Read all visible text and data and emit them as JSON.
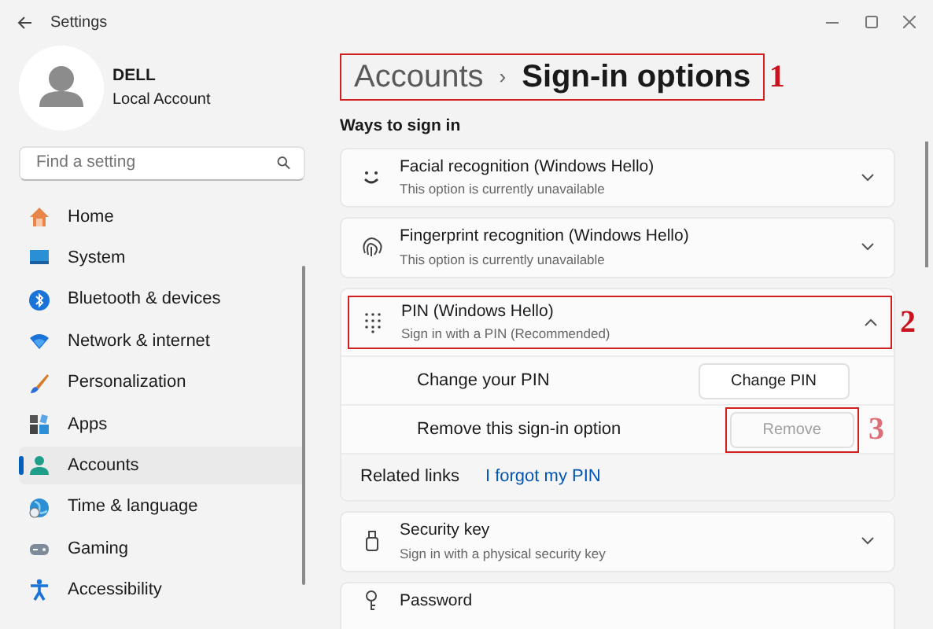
{
  "window": {
    "title": "Settings"
  },
  "profile": {
    "name": "DELL",
    "account_type": "Local Account"
  },
  "search": {
    "placeholder": "Find a setting"
  },
  "nav": [
    {
      "label": "Home",
      "selected": false
    },
    {
      "label": "System",
      "selected": false
    },
    {
      "label": "Bluetooth & devices",
      "selected": false
    },
    {
      "label": "Network & internet",
      "selected": false
    },
    {
      "label": "Personalization",
      "selected": false
    },
    {
      "label": "Apps",
      "selected": false
    },
    {
      "label": "Accounts",
      "selected": true
    },
    {
      "label": "Time & language",
      "selected": false
    },
    {
      "label": "Gaming",
      "selected": false
    },
    {
      "label": "Accessibility",
      "selected": false
    }
  ],
  "breadcrumb": {
    "parent": "Accounts",
    "separator": "›",
    "current": "Sign-in options",
    "annotation": "1"
  },
  "section_title": "Ways to sign in",
  "options": [
    {
      "title": "Facial recognition (Windows Hello)",
      "subtitle": "This option is currently unavailable",
      "expanded": false
    },
    {
      "title": "Fingerprint recognition (Windows Hello)",
      "subtitle": "This option is currently unavailable",
      "expanded": false
    },
    {
      "title": "PIN (Windows Hello)",
      "subtitle": "Sign in with a PIN (Recommended)",
      "expanded": true,
      "annotation": "2",
      "settings": [
        {
          "label": "Change your PIN",
          "button": "Change PIN",
          "disabled": false
        },
        {
          "label": "Remove this sign-in option",
          "button": "Remove",
          "disabled": true,
          "annotation": "3"
        }
      ],
      "related_links": {
        "label": "Related links",
        "links": [
          "I forgot my PIN"
        ]
      }
    },
    {
      "title": "Security key",
      "subtitle": "Sign in with a physical security key",
      "expanded": false
    },
    {
      "title": "Password"
    }
  ]
}
